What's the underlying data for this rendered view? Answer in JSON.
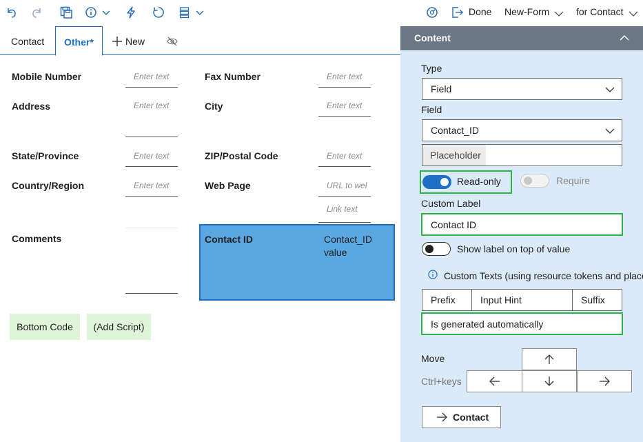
{
  "toolbar": {
    "done_label": "Done",
    "form_dropdown_value": "New-Form",
    "target_dropdown_value": "for Contact"
  },
  "tabs": [
    {
      "label": "Contact"
    },
    {
      "label": "Other*"
    },
    {
      "label": "New"
    }
  ],
  "form": {
    "fields": [
      {
        "label": "Mobile Number",
        "placeholder": "Enter text"
      },
      {
        "label": "Fax Number",
        "placeholder": "Enter text"
      },
      {
        "label": "Address",
        "placeholder": "Enter text"
      },
      {
        "label": "City",
        "placeholder": "Enter text"
      },
      {
        "label": "State/Province",
        "placeholder": "Enter text"
      },
      {
        "label": "ZIP/Postal Code",
        "placeholder": "Enter text"
      },
      {
        "label": "Country/Region",
        "placeholder": "Enter text"
      },
      {
        "label": "Web Page",
        "placeholder": "URL to wel",
        "link_placeholder": "Link text"
      },
      {
        "label": "Comments"
      }
    ],
    "selected_field": {
      "label": "Contact ID",
      "value_line1": "Contact_ID",
      "value_line2": "value"
    },
    "bottom_buttons": [
      {
        "label": "Bottom Code"
      },
      {
        "label": "(Add Script)"
      }
    ]
  },
  "panel": {
    "title": "Content",
    "type_label": "Type",
    "type_value": "Field",
    "field_label": "Field",
    "field_value": "Contact_ID",
    "placeholder_label": "Placeholder",
    "readonly_label": "Read-only",
    "readonly_on": true,
    "require_label": "Require",
    "require_on": false,
    "custom_label_label": "Custom Label",
    "custom_label_value": "Contact ID",
    "show_label_on_top": "Show label on top of value",
    "show_label_on": false,
    "custom_texts_label": "Custom Texts (using resource tokens and placeho",
    "prefix_label": "Prefix",
    "input_hint_label": "Input Hint",
    "suffix_label": "Suffix",
    "auto_text": "Is generated automatically",
    "move_label": "Move",
    "ctrl_keys_label": "Ctrl+keys",
    "goto_label": "Contact"
  },
  "colors": {
    "accent": "#1d6ec5",
    "selected_field_bg": "#5ba7e1",
    "panel_bg": "#dbeaf8",
    "panel_header": "#6b7785",
    "highlight_green": "#2db24a",
    "script_button_bg": "#dff4d8"
  }
}
